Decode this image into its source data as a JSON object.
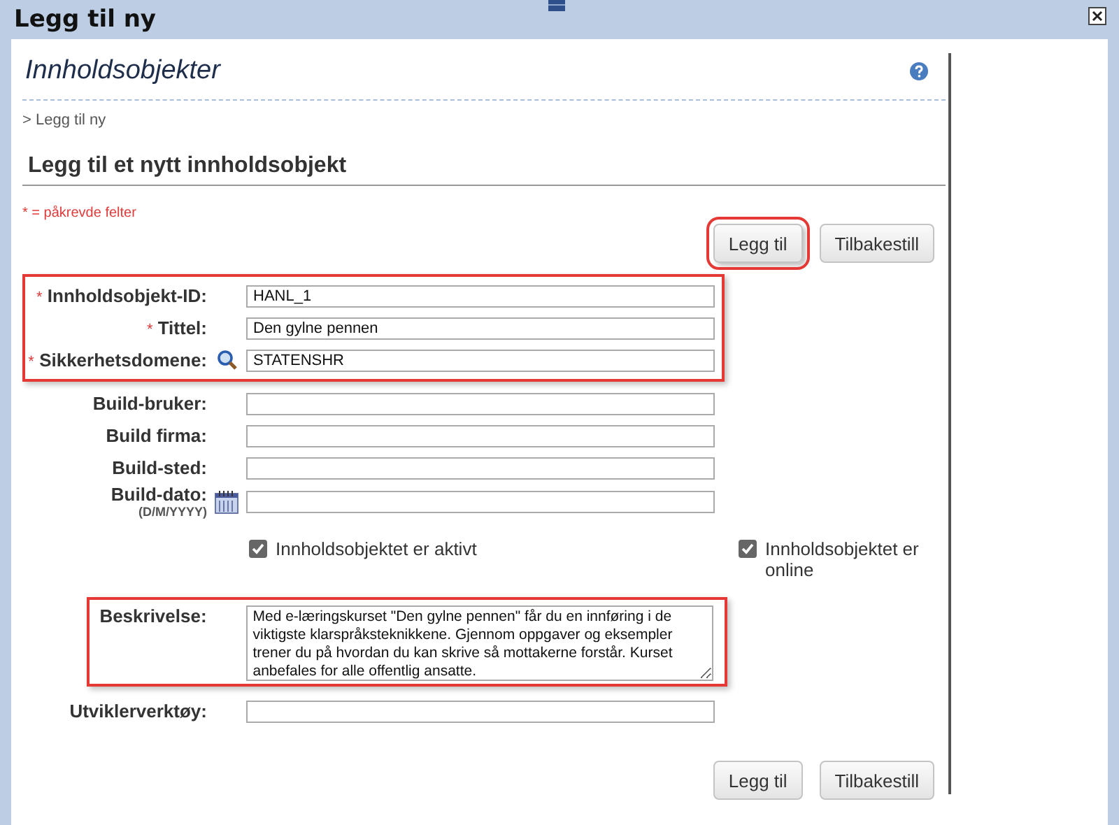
{
  "window": {
    "title": "Legg til ny"
  },
  "page": {
    "title": "Innholdsobjekter",
    "breadcrumb": "> Legg til ny",
    "heading": "Legg til et nytt innholdsobjekt",
    "required_note": "* = påkrevde felter"
  },
  "top_buttons": [
    {
      "label": "Legg til",
      "highlighted": true
    },
    {
      "label": "Tilbakestill",
      "highlighted": false
    }
  ],
  "field_groups": [
    {
      "highlighted": true,
      "fields": [
        {
          "kind": "text",
          "required_mark": "*",
          "label": "Innholdsobjekt-ID:",
          "value": "HANL_1"
        },
        {
          "kind": "text",
          "required_mark": "*",
          "label": "Tittel:",
          "value": "Den gylne pennen"
        },
        {
          "kind": "lookup",
          "required_mark": "*",
          "label": "Sikkerhetsdomene:",
          "value": "STATENSHR"
        }
      ]
    },
    {
      "highlighted": false,
      "fields": [
        {
          "kind": "text",
          "label": "Build-bruker:"
        },
        {
          "kind": "text",
          "label": "Build firma:"
        },
        {
          "kind": "text",
          "label": "Build-sted:"
        },
        {
          "kind": "date",
          "label": "Build-dato:",
          "hint": "(D/M/YYYY)"
        }
      ]
    }
  ],
  "checkboxes": [
    {
      "label": "Innholdsobjektet er aktivt",
      "checked": true
    },
    {
      "label": "Innholdsobjektet er online",
      "checked": true
    }
  ],
  "description": {
    "label": "Beskrivelse:",
    "value": "Med e-læringskurset \"Den gylne pennen\" får du en innføring i de viktigste klarspråksteknikkene. Gjennom oppgaver og eksempler trener du på hvordan du kan skrive så mottakerne forstår. Kurset anbefales for alle offentlig ansatte.",
    "highlighted": true
  },
  "developer_tools": {
    "label": "Utviklerverktøy:"
  },
  "bottom_buttons": [
    {
      "label": "Legg til",
      "highlighted": false
    },
    {
      "label": "Tilbakestill",
      "highlighted": false
    }
  ]
}
